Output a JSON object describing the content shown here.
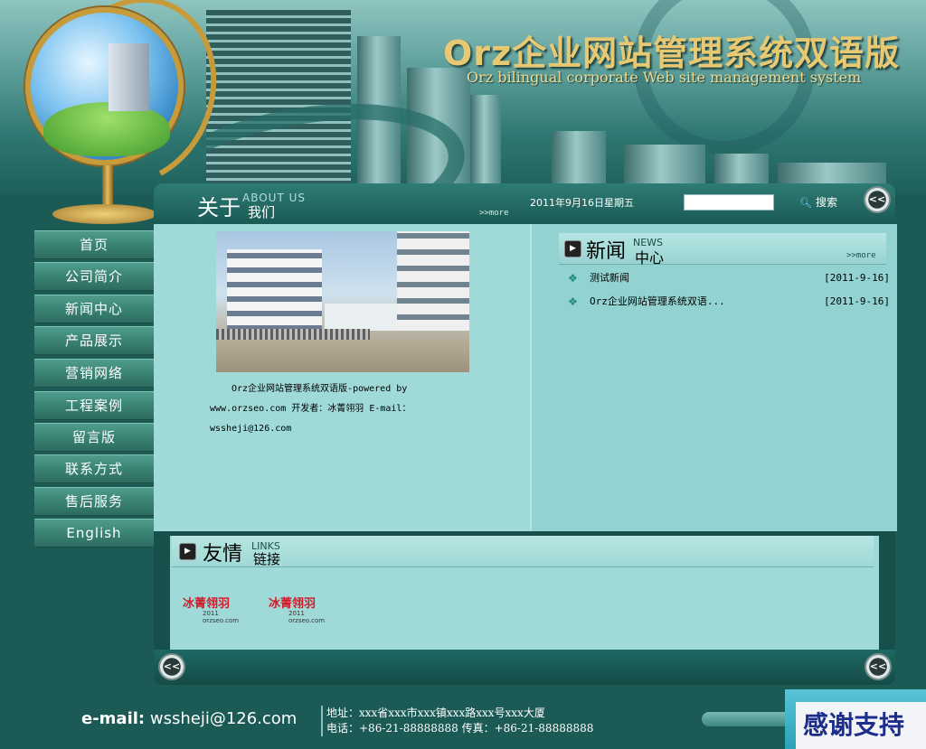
{
  "header": {
    "title": "Orz企业网站管理系统双语版",
    "subtitle": "Orz bilingual corporate Web site management system"
  },
  "nav": [
    {
      "label": "首页"
    },
    {
      "label": "公司简介"
    },
    {
      "label": "新闻中心"
    },
    {
      "label": "产品展示"
    },
    {
      "label": "营销网络"
    },
    {
      "label": "工程案例"
    },
    {
      "label": "留言版"
    },
    {
      "label": "联系方式"
    },
    {
      "label": "售后服务"
    },
    {
      "label": "English"
    }
  ],
  "topbar": {
    "about_cn": "关于",
    "about_en": "ABOUT US",
    "about_cn2": "我们",
    "more": ">>more",
    "date": "2011年9月16日星期五",
    "search_value": "",
    "search_label": "搜索",
    "collapse_label": "<<"
  },
  "about": {
    "line1": "Orz企业网站管理系统双语版-powered by",
    "line2": "www.orzseo.com 开发者：冰菁翎羽 E-mail：",
    "line3": "wssheji@126.com"
  },
  "news": {
    "title_cn": "新闻",
    "title_en": "NEWS",
    "title_cn2": "中心",
    "more": ">>more",
    "items": [
      {
        "title": "测试新闻",
        "date": "[2011-9-16]"
      },
      {
        "title": "Orz企业网站管理系统双语...",
        "date": "[2011-9-16]"
      }
    ]
  },
  "links": {
    "title_cn": "友情",
    "title_en": "LINKS",
    "title_cn2": "链接",
    "logos": [
      {
        "name": "冰菁翎羽",
        "sub": "2011 orzseo.com"
      },
      {
        "name": "冰菁翎羽",
        "sub": "2011 orzseo.com"
      }
    ]
  },
  "footer": {
    "email_label": "e-mail:",
    "email": "wssheji@126.com",
    "address": "地址：xxx省xxx市xxx镇xxx路xxx号xxx大厦",
    "phone": "电话：+86-21-88888888 传真：+86-21-88888888",
    "thanks": "感谢支持"
  }
}
